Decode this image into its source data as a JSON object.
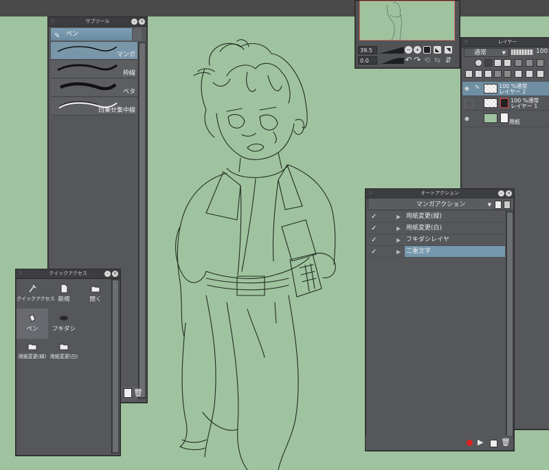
{
  "subtool": {
    "title": "サブツール",
    "group": "ペン",
    "brushes": [
      {
        "label": "マンガ",
        "selected": true
      },
      {
        "label": "枠線",
        "selected": false
      },
      {
        "label": "ベタ",
        "selected": false
      },
      {
        "label": "白乗せ集中線",
        "selected": false
      }
    ]
  },
  "quick_access": {
    "title": "クイックアクセス",
    "items": [
      {
        "label": "クイックアクセス",
        "icon": "eyedropper-icon"
      },
      {
        "label": "新規",
        "icon": "new-document-icon"
      },
      {
        "label": "開く",
        "icon": "open-folder-icon"
      },
      {
        "label": "ペン",
        "icon": "pen-icon",
        "selected": true
      },
      {
        "label": "フキダシ",
        "icon": "speech-balloon-icon"
      },
      {
        "label": "用紙変更(緑)",
        "icon": "folder-icon"
      },
      {
        "label": "用紙変更(白)",
        "icon": "folder-icon"
      }
    ]
  },
  "navigator": {
    "zoom": "39.5",
    "angle": "0.0"
  },
  "layer": {
    "title": "レイヤー",
    "blend_mode": "通常",
    "opacity": "100",
    "layers": [
      {
        "line1": "100 %通常",
        "line2": "レイヤー 2",
        "visible": true,
        "selected": true
      },
      {
        "line1": "100 %通常",
        "line2": "レイヤー 1",
        "visible": false,
        "selected": false
      },
      {
        "line1": "",
        "line2": "用紙",
        "visible": true,
        "selected": false
      }
    ]
  },
  "auto_action": {
    "title": "オートアクション",
    "set": "マンガアクション",
    "actions": [
      {
        "label": "用紙変更(緑)",
        "checked": true,
        "selected": false
      },
      {
        "label": "用紙変更(白)",
        "checked": true,
        "selected": false
      },
      {
        "label": "フキダシレイヤ",
        "checked": true,
        "selected": false
      },
      {
        "label": "二重文字",
        "checked": true,
        "selected": true
      }
    ]
  },
  "colors": {
    "canvas": "#9fc39f",
    "panel": "#55575b",
    "selection": "#7497ad",
    "record": "#e02020"
  }
}
